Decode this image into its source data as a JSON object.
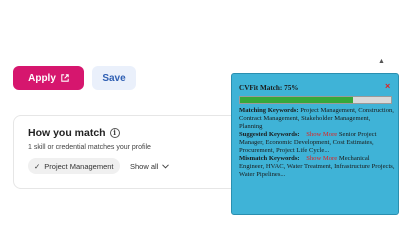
{
  "actions": {
    "apply_label": "Apply",
    "save_label": "Save"
  },
  "match": {
    "title": "How you match",
    "subtitle": "1 skill or credential matches your profile",
    "skill": "Project Management",
    "show_all": "Show all"
  },
  "cvfit": {
    "title": "CVFit Match: 75%",
    "match_percent": 75,
    "close_symbol": "×",
    "matching_label": "Matching Keywords:",
    "matching_text": "Project Management, Construction, Contract Management, Stakeholder Management, Planning",
    "suggested_label": "Suggested Keywords:",
    "suggested_show_more": "Show More",
    "suggested_text": "Senior Project Manager, Economic Development, Cost Estimates, Procurement, Project Life Cycle...",
    "mismatch_label": "Mismatch Keywords:",
    "mismatch_show_more": "Show More",
    "mismatch_text": "Mechanical Engineer, HVAC, Water Treatment, Infrastructure Projects, Water Pipelines...",
    "accent_color": "#3fb3d7",
    "progress_color": "#35a83a"
  },
  "colors": {
    "apply_bg": "#d6166e",
    "save_text": "#2f5fb3"
  }
}
